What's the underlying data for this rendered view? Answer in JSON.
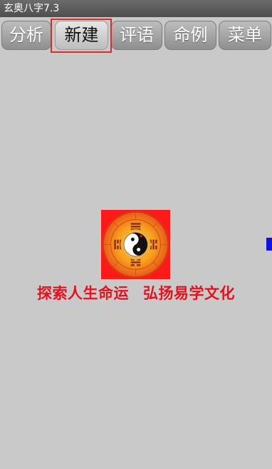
{
  "app": {
    "title": "玄奥八字7.3"
  },
  "tabs": [
    {
      "label": "分析"
    },
    {
      "label": "新建"
    },
    {
      "label": "评语"
    },
    {
      "label": "命例"
    },
    {
      "label": "菜单"
    }
  ],
  "active_tab": 1,
  "main": {
    "slogan_left": "探索人生命运",
    "slogan_right": "弘扬易学文化",
    "logo_icon": "bagua-yinyang-icon"
  },
  "colors": {
    "slogan": "#e8101d",
    "logo_background": "#ff1a1a",
    "logo_ring": "#f59a1c",
    "selection_frame": "#e02a2a"
  }
}
